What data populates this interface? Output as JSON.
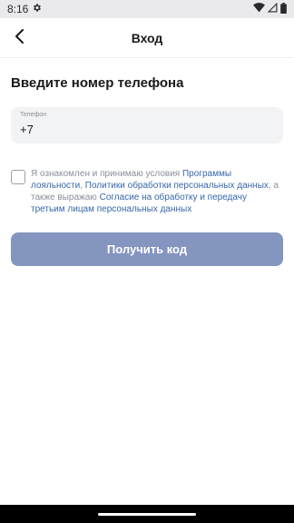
{
  "status_bar": {
    "time": "8:16",
    "icons": [
      "settings-icon",
      "wifi-icon",
      "signal-icon",
      "battery-icon"
    ]
  },
  "app_bar": {
    "title": "Вход",
    "back_icon": "chevron-left-icon"
  },
  "heading": "Введите номер телефона",
  "phone_field": {
    "label": "Телефон",
    "value": "+7"
  },
  "consent": {
    "checked": false,
    "text_1": "Я ознакомлен и принимаю условия ",
    "link_1": "Программы лояльности",
    "text_2": ", ",
    "link_2": "Политики обработки персональных данных",
    "text_3": ", а также выражаю ",
    "link_3": "Согласие на обработку и передачу третьим лицам персональных данных"
  },
  "primary_button": {
    "label": "Получить код"
  },
  "colors": {
    "accent_link": "#3667a8",
    "button_bg": "#8496bf",
    "field_bg": "#f2f3f5"
  }
}
